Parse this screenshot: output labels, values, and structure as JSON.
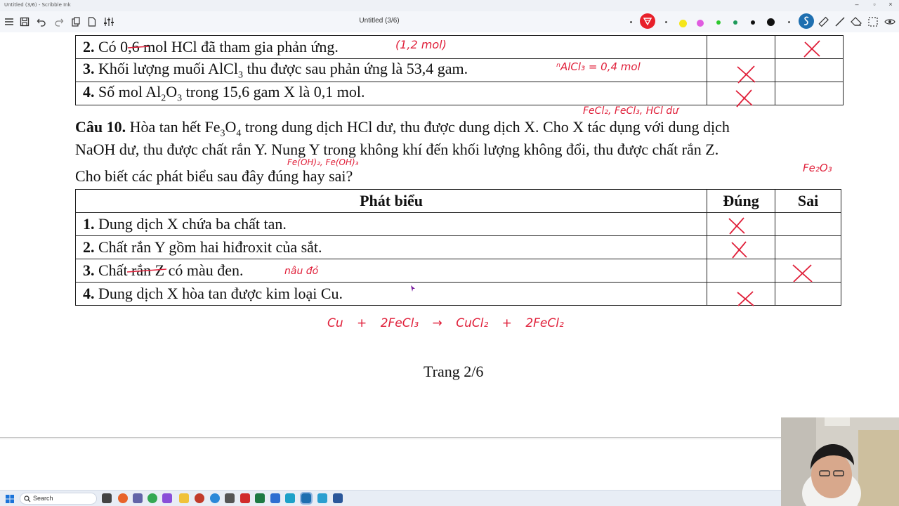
{
  "window": {
    "title": "Untitled (3/6) - Scribble Ink",
    "controls": [
      "–",
      "▫",
      "×"
    ]
  },
  "toolbar": {
    "doc_title": "Untitled (3/6)",
    "left_tools": [
      "menu-icon",
      "save-icon",
      "undo-icon",
      "redo-icon",
      "paste-icon",
      "new-page-icon",
      "settings-sliders-icon"
    ],
    "colors": [
      "#e8202a",
      "#f5e61a",
      "#e05ce0",
      "#2ec82e",
      "#1e9a5a",
      "#111111",
      "#111111",
      "#1e6fb0"
    ],
    "right_tools": [
      "ruler-icon",
      "line-icon",
      "eraser-icon",
      "lasso-select-icon",
      "fit-width-icon"
    ]
  },
  "prev_table": {
    "rows": [
      {
        "num": "2.",
        "text": "Có 0,6 mol HCl đã tham gia phản ứng.",
        "dung": "",
        "sai": "✕"
      },
      {
        "num": "3.",
        "text_html_pre": "Khối lượng muối AlCl",
        "sub": "3",
        "text_post": " thu được sau phản ứng là 53,4 gam.",
        "dung": "✕",
        "sai": ""
      },
      {
        "num": "4.",
        "text_pre": "Số mol Al",
        "sub1": "2",
        "mid": "O",
        "sub2": "3",
        "text_post": " trong 15,6 gam X là 0,1 mol.",
        "dung": "✕",
        "sai": ""
      }
    ]
  },
  "question": {
    "label": "Câu 10.",
    "line1_pre": " Hòa tan hết Fe",
    "sub1": "3",
    "mid1": "O",
    "sub2": "4",
    "line1_post": " trong dung dịch HCl dư, thu được dung dịch X. Cho X tác dụng với dung dịch",
    "line2": "NaOH dư, thu được chất rắn Y. Nung Y trong không khí đến khối lượng không đổi, thu được chất rắn Z.",
    "line3": "Cho biết các phát biểu sau đây đúng hay sai?"
  },
  "table": {
    "headers": [
      "Phát biểu",
      "Đúng",
      "Sai"
    ],
    "rows": [
      {
        "num": "1.",
        "text": "Dung dịch X chứa ba chất tan.",
        "dung": "✕",
        "sai": ""
      },
      {
        "num": "2.",
        "text": "Chất rắn Y gồm hai hiđroxit của sắt.",
        "dung": "✕",
        "sai": ""
      },
      {
        "num": "3.",
        "text": "Chất rắn Z có màu đen.",
        "dung": "",
        "sai": "✕"
      },
      {
        "num": "4.",
        "text": "Dung dịch X hòa tan được kim loại Cu.",
        "dung": "✕",
        "sai": ""
      }
    ]
  },
  "page_footer": "Trang 2/6",
  "ink_notes": {
    "mol_1_2": "(1,2 mol)",
    "n_alcl3": "ⁿAlCl₃ = 0,4 mol",
    "x_components": "FeCl₂, FeCl₃, HCl dư",
    "y_components": "Fe(OH)₂, Fe(OH)₃",
    "z_formula": "Fe₂O₃",
    "color_note": "nâu đỏ",
    "equation": "Cu + 2FeCl₃ → CuCl₂ + 2FeCl₂"
  },
  "taskbar": {
    "search_label": "Search"
  }
}
